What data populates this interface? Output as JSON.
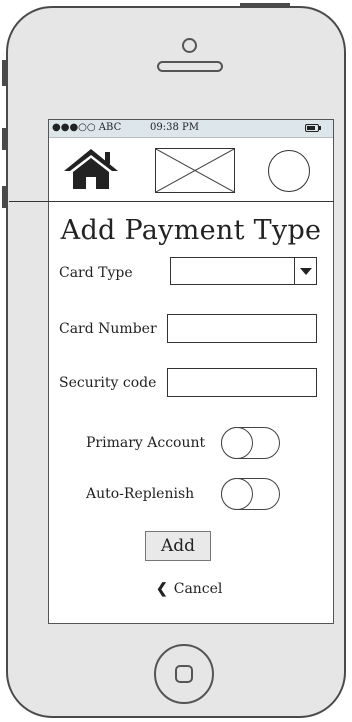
{
  "status_bar": {
    "carrier": "●●●○○ ABC",
    "time": "09:38 PM",
    "battery_icon": "battery-icon"
  },
  "nav": {
    "home_icon": "home-icon",
    "image_placeholder": "image-placeholder",
    "circle_icon": "circle-icon"
  },
  "page": {
    "title": "Add Payment Type"
  },
  "form": {
    "card_type_label": "Card Type",
    "card_type_value": "",
    "card_number_label": "Card Number",
    "card_number_value": "",
    "security_code_label": "Security code",
    "security_code_value": "",
    "primary_account_label": "Primary Account",
    "primary_account_on": false,
    "auto_replenish_label": "Auto-Replenish",
    "auto_replenish_on": false,
    "add_label": "Add",
    "cancel_label": "Cancel"
  },
  "colors": {
    "device_body": "#e6e6e6",
    "device_outline": "#4a4a4a",
    "status_bar_bg": "#dde6ea"
  }
}
